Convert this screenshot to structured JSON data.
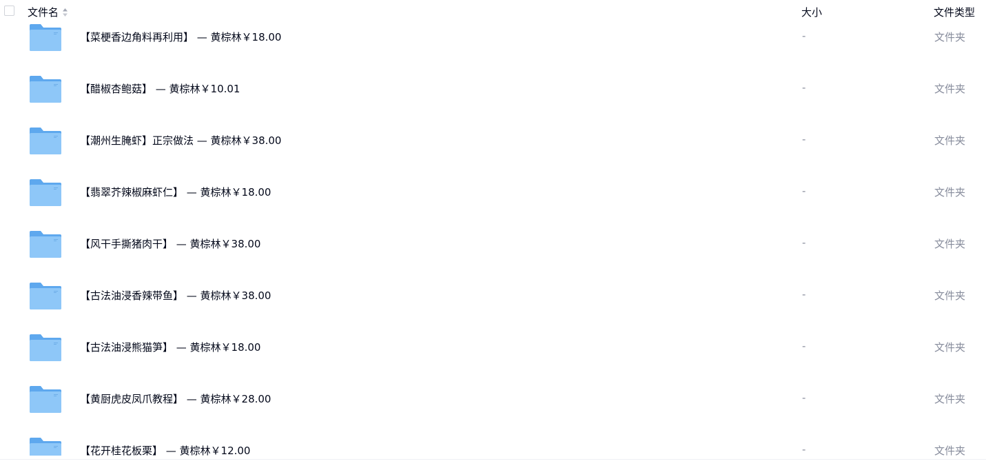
{
  "header": {
    "name_label": "文件名",
    "size_label": "大小",
    "type_label": "文件类型"
  },
  "rows": [
    {
      "name": "【菜梗香边角料再利用】 — 黄棕林￥18.00",
      "size": "-",
      "type": "文件夹"
    },
    {
      "name": "【醋椒杏鲍菇】 — 黄棕林￥10.01",
      "size": "-",
      "type": "文件夹"
    },
    {
      "name": "【潮州生腌虾】正宗做法 — 黄棕林￥38.00",
      "size": "-",
      "type": "文件夹"
    },
    {
      "name": "【翡翠芥辣椒麻虾仁】 — 黄棕林￥18.00",
      "size": "-",
      "type": "文件夹"
    },
    {
      "name": "【风干手撕猪肉干】 — 黄棕林￥38.00",
      "size": "-",
      "type": "文件夹"
    },
    {
      "name": "【古法油浸香辣带鱼】 — 黄棕林￥38.00",
      "size": "-",
      "type": "文件夹"
    },
    {
      "name": "【古法油浸熊猫笋】 — 黄棕林￥18.00",
      "size": "-",
      "type": "文件夹"
    },
    {
      "name": "【黄厨虎皮凤爪教程】 — 黄棕林￥28.00",
      "size": "-",
      "type": "文件夹"
    },
    {
      "name": "【花开桂花板栗】 — 黄棕林￥12.00",
      "size": "-",
      "type": "文件夹"
    }
  ],
  "colors": {
    "text_primary": "#03081a",
    "text_secondary": "#878c9c",
    "folder_back": "#5ea8ee",
    "folder_front": "#8ec7f8"
  },
  "icons": {
    "row_icon": "folder-icon",
    "sort": "sort-icon"
  }
}
